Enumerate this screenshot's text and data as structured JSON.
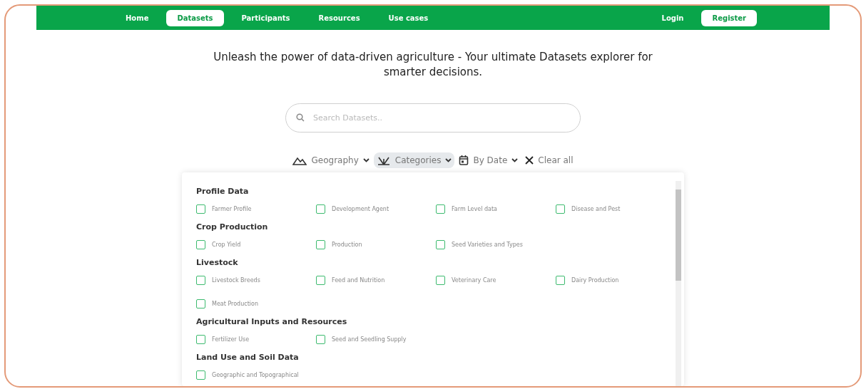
{
  "nav": {
    "items": [
      {
        "label": "Home",
        "selected": false
      },
      {
        "label": "Datasets",
        "selected": true
      },
      {
        "label": "Participants",
        "selected": false
      },
      {
        "label": "Resources",
        "selected": false
      },
      {
        "label": "Use cases",
        "selected": false
      }
    ],
    "auth": [
      {
        "label": "Login",
        "selected": false
      },
      {
        "label": "Register",
        "selected": true
      }
    ]
  },
  "headline": "Unleash the power of data-driven agriculture - Your ultimate Datasets explorer for smarter decisions.",
  "search": {
    "placeholder": "Search Datasets.."
  },
  "filters": [
    {
      "kind": "geography",
      "label": "Geography",
      "selected": false
    },
    {
      "kind": "categories",
      "label": "Categories",
      "selected": true
    },
    {
      "kind": "date",
      "label": "By Date",
      "selected": false
    }
  ],
  "clear": "Clear all",
  "groups": [
    {
      "title": "Profile Data",
      "items": [
        {
          "label": "Farmer Profile",
          "checked": false
        },
        {
          "label": "Development Agent",
          "checked": false
        },
        {
          "label": "Farm Level data",
          "checked": false
        },
        {
          "label": "Disease and Pest",
          "checked": false
        }
      ]
    },
    {
      "title": "Crop Production",
      "items": [
        {
          "label": "Crop Yield",
          "checked": false
        },
        {
          "label": "Production",
          "checked": false
        },
        {
          "label": "Seed Varieties and Types",
          "checked": false
        }
      ]
    },
    {
      "title": "Livestock",
      "items": [
        {
          "label": "Livestock Breeds",
          "checked": false
        },
        {
          "label": "Feed and Nutrition",
          "checked": false
        },
        {
          "label": "Veterinary Care",
          "checked": false
        },
        {
          "label": "Dairy Production",
          "checked": false
        },
        {
          "label": "Meat Production",
          "checked": false
        }
      ]
    },
    {
      "title": "Agricultural Inputs and Resources",
      "items": [
        {
          "label": "Fertilizer Use",
          "checked": false
        },
        {
          "label": "Seed and Seedling Supply",
          "checked": false
        }
      ]
    },
    {
      "title": "Land Use and Soil Data",
      "items": [
        {
          "label": "Geographic and Topographical",
          "checked": false
        }
      ]
    }
  ]
}
